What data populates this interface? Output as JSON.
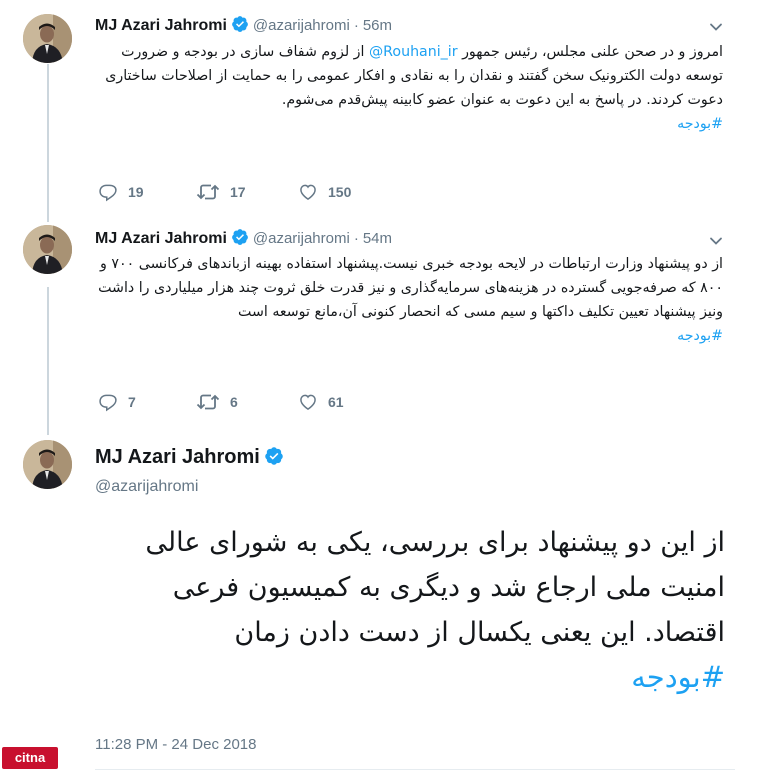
{
  "tweets": [
    {
      "name": "MJ Azari Jahromi",
      "handle": "@azarijahromi",
      "dot": "·",
      "time": "56m",
      "text_before_mention": "امروز و در صحن علنی مجلس، رئیس جمهور ",
      "mention": "@Rouhani_ir",
      "text_after_mention": " از لزوم شفاف سازی در بودجه و ضرورت توسعه دولت الکترونیک سخن گفتند و نقدان را به نقادی و افکار عمومی را به حمایت از اصلاحات ساختاری دعوت کردند. در پاسخ به این دعوت به عنوان عضو کابینه پیش‌قدم می‌شوم.",
      "hashtag": "#بودجه",
      "replies": "19",
      "retweets": "17",
      "likes": "150"
    },
    {
      "name": "MJ Azari Jahromi",
      "handle": "@azarijahromi",
      "dot": "·",
      "time": "54m",
      "text": "از دو پیشنهاد وزارت ارتباطات در لایحه بودجه خبری نیست.پیشنهاد استفاده بهینه ازباندهای فرکانسی ۷۰۰ و ۸۰۰ که صرفه‌جویی گسترده در هزینه‌های سرمایه‌گذاری و نیز قدرت خلق ثروت چند هزار میلیاردی را داشت ونیز پیشنهاد تعیین تکلیف داکتها و سیم مسی که انحصار کنونی آن،مانع توسعه است",
      "hashtag": "#بودجه",
      "replies": "7",
      "retweets": "6",
      "likes": "61"
    }
  ],
  "main_tweet": {
    "name": "MJ Azari Jahromi",
    "handle": "@azarijahromi",
    "text": "از این دو پیشنهاد برای بررسی، یکی به شورای عالی امنیت ملی ارجاع شد و دیگری به کمیسیون فرعی اقتصاد. این یعنی یکسال از دست دادن زمان",
    "hashtag": "#بودجه",
    "timestamp": "11:28 PM - 24 Dec 2018"
  },
  "watermark": "citna",
  "colors": {
    "accent": "#1da1f2",
    "muted": "#657786",
    "text": "#14171a",
    "thread_line": "#ccd6dd",
    "watermark_bg": "#c8102e"
  },
  "icons": {
    "reply": "reply-icon",
    "retweet": "retweet-icon",
    "like": "heart-icon",
    "verified": "verified-badge-icon",
    "caret": "chevron-down-icon"
  }
}
